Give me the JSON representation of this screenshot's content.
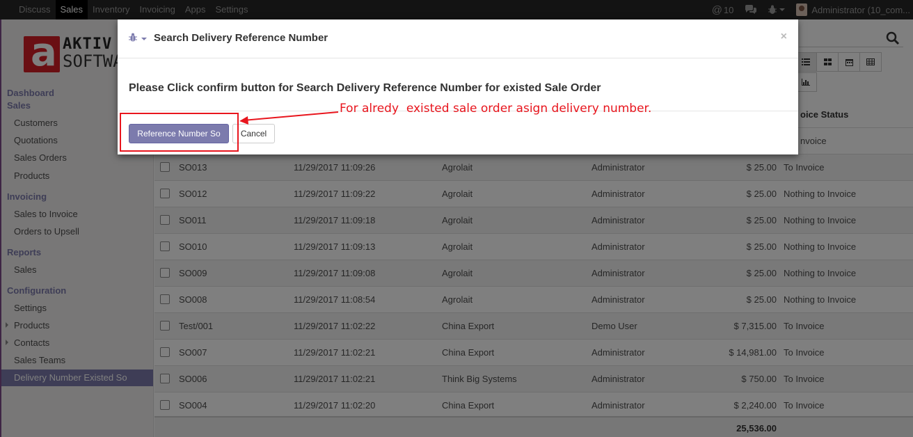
{
  "topnav": {
    "menu": [
      "Discuss",
      "Sales",
      "Inventory",
      "Invoicing",
      "Apps",
      "Settings"
    ],
    "active": "Sales",
    "mentions_count": "10",
    "user": "Administrator (10_com..."
  },
  "sidebar": {
    "sections": [
      {
        "title": "Dashboard"
      },
      {
        "title": "Sales",
        "items": [
          "Customers",
          "Quotations",
          "Sales Orders",
          "Products"
        ]
      },
      {
        "title": "Invoicing",
        "items": [
          "Sales to Invoice",
          "Orders to Upsell"
        ]
      },
      {
        "title": "Reports",
        "items": [
          "Sales"
        ]
      },
      {
        "title": "Configuration",
        "items": [
          "Settings",
          "Products",
          "Contacts",
          "Sales Teams",
          "Delivery Number Existed So"
        ]
      }
    ],
    "active_item": "Delivery Number Existed So"
  },
  "logo": {
    "line1": "AKTIV",
    "line2": "SOFTWARE",
    "mark": "a"
  },
  "grid": {
    "header_visible": "oice Status",
    "partial_top_row_status": "nvoice",
    "rows": [
      {
        "number": "SO013",
        "date": "11/29/2017 11:09:26",
        "customer": "Agrolait",
        "salesperson": "Administrator",
        "total": "$ 25.00",
        "status": "To Invoice"
      },
      {
        "number": "SO012",
        "date": "11/29/2017 11:09:22",
        "customer": "Agrolait",
        "salesperson": "Administrator",
        "total": "$ 25.00",
        "status": "Nothing to Invoice"
      },
      {
        "number": "SO011",
        "date": "11/29/2017 11:09:18",
        "customer": "Agrolait",
        "salesperson": "Administrator",
        "total": "$ 25.00",
        "status": "Nothing to Invoice"
      },
      {
        "number": "SO010",
        "date": "11/29/2017 11:09:13",
        "customer": "Agrolait",
        "salesperson": "Administrator",
        "total": "$ 25.00",
        "status": "Nothing to Invoice"
      },
      {
        "number": "SO009",
        "date": "11/29/2017 11:09:08",
        "customer": "Agrolait",
        "salesperson": "Administrator",
        "total": "$ 25.00",
        "status": "Nothing to Invoice"
      },
      {
        "number": "SO008",
        "date": "11/29/2017 11:08:54",
        "customer": "Agrolait",
        "salesperson": "Administrator",
        "total": "$ 25.00",
        "status": "Nothing to Invoice"
      },
      {
        "number": "Test/001",
        "date": "11/29/2017 11:02:22",
        "customer": "China Export",
        "salesperson": "Demo User",
        "total": "$ 7,315.00",
        "status": "To Invoice"
      },
      {
        "number": "SO007",
        "date": "11/29/2017 11:02:21",
        "customer": "China Export",
        "salesperson": "Administrator",
        "total": "$ 14,981.00",
        "status": "To Invoice"
      },
      {
        "number": "SO006",
        "date": "11/29/2017 11:02:21",
        "customer": "Think Big Systems",
        "salesperson": "Administrator",
        "total": "$ 750.00",
        "status": "To Invoice"
      },
      {
        "number": "SO004",
        "date": "11/29/2017 11:02:20",
        "customer": "China Export",
        "salesperson": "Administrator",
        "total": "$ 2,240.00",
        "status": "To Invoice"
      }
    ],
    "sum_total": "25,536.00"
  },
  "modal": {
    "title": "Search Delivery Reference Number",
    "close": "×",
    "message": "Please Click confirm button for Search Delivery Reference Number for existed Sale Order",
    "primary_button": "Reference Number So",
    "cancel_button": "Cancel"
  },
  "annotation": {
    "text": "For alredy  existed sale order asign delivery number."
  },
  "colors": {
    "accent": "#7c7bad",
    "topbar": "#262626",
    "annotation": "#e8151d",
    "brand_red": "#d51e26"
  }
}
